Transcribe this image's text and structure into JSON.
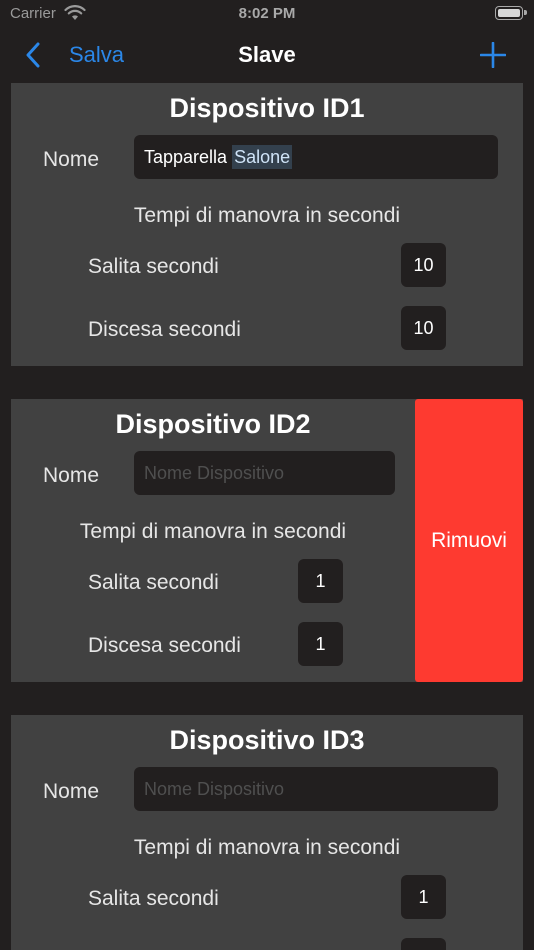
{
  "status": {
    "carrier": "Carrier",
    "time": "8:02 PM"
  },
  "nav": {
    "back_label": "Salva",
    "title": "Slave"
  },
  "colors": {
    "accent": "#2b87e8",
    "destructive": "#fe3a30",
    "card": "#414141",
    "background": "#221f1f"
  },
  "devices": [
    {
      "title": "Dispositivo ID1",
      "name_label": "Nome",
      "name_value_part1": "Tapparella",
      "name_value_selected": "Salone",
      "name_placeholder": "",
      "section_title": "Tempi di manovra in secondi",
      "up_label": "Salita secondi",
      "up_value": "10",
      "down_label": "Discesa secondi",
      "down_value": "10"
    },
    {
      "title": "Dispositivo ID2",
      "name_label": "Nome",
      "name_placeholder": "Nome Dispositivo",
      "section_title": "Tempi di manovra in secondi",
      "up_label": "Salita secondi",
      "up_value": "1",
      "down_label": "Discesa secondi",
      "down_value": "1",
      "remove_label": "Rimuovi"
    },
    {
      "title": "Dispositivo ID3",
      "name_label": "Nome",
      "name_placeholder": "Nome Dispositivo",
      "section_title": "Tempi di manovra in secondi",
      "up_label": "Salita secondi",
      "up_value": "1",
      "down_label": "Discesa secondi",
      "down_value": ""
    }
  ]
}
